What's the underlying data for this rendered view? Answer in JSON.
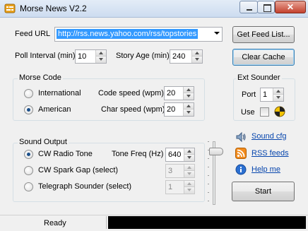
{
  "window": {
    "title": "Morse News V2.2"
  },
  "feed": {
    "label": "Feed URL",
    "url": "http://rss.news.yahoo.com/rss/topstories",
    "get_feed_button": "Get Feed List..."
  },
  "poll": {
    "poll_label": "Poll Interval (min)",
    "poll_value": "10",
    "story_age_label": "Story Age (min)",
    "story_age_value": "240",
    "clear_cache_button": "Clear Cache"
  },
  "morse_code": {
    "title": "Morse Code",
    "international_label": "International",
    "american_label": "American",
    "selected": "American",
    "code_speed_label": "Code speed (wpm)",
    "code_speed_value": "20",
    "char_speed_label": "Char speed (wpm)",
    "char_speed_value": "20"
  },
  "ext_sounder": {
    "title": "Ext Sounder",
    "port_label": "Port",
    "port_value": "1",
    "use_label": "Use",
    "use_checked": false
  },
  "sound_output": {
    "title": "Sound Output",
    "options": [
      {
        "label": "CW Radio Tone",
        "selected": true
      },
      {
        "label": "CW Spark Gap (select)",
        "selected": false
      },
      {
        "label": "Telegraph Sounder (select)",
        "selected": false
      }
    ],
    "tone_freq_label": "Tone Freq (Hz)",
    "tone_freq_value": "640",
    "spark_gap_value": "3",
    "sounder_value": "1"
  },
  "links": {
    "sound_cfg": "Sound cfg",
    "rss_feeds": "RSS feeds",
    "help_me": "Help me"
  },
  "start_button": "Start",
  "status": {
    "text": "Ready"
  },
  "colors": {
    "link": "#0645ad",
    "selection": "#3399ff"
  }
}
